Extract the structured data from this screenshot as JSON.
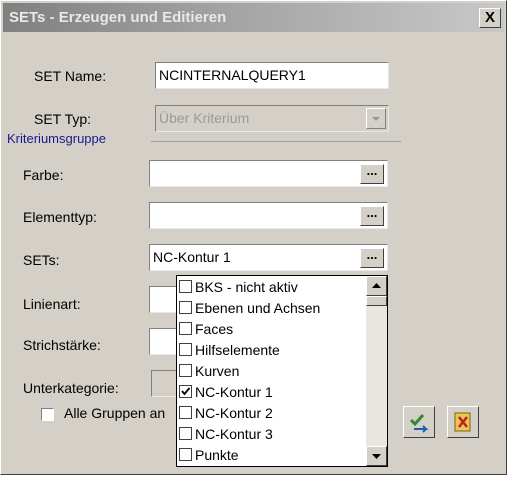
{
  "window": {
    "title": "SETs - Erzeugen und Editieren",
    "close_label": "X"
  },
  "form": {
    "set_name": {
      "label": "SET Name:",
      "value": "NCINTERNALQUERY1"
    },
    "set_typ": {
      "label": "SET Typ:",
      "value": "Über Kriterium"
    },
    "group_label": "Kriteriumsgruppe",
    "farbe": {
      "label": "Farbe:",
      "value": "",
      "button": "..."
    },
    "elementtyp": {
      "label": "Elementtyp:",
      "value": "",
      "button": "..."
    },
    "sets": {
      "label": "SETs:",
      "value": "NC-Kontur 1",
      "button": "..."
    },
    "linienart": {
      "label": "Linienart:"
    },
    "strichstaerke": {
      "label": "Strichstärke:"
    },
    "unterkategorie": {
      "label": "Unterkategorie:"
    },
    "alle_gruppen": {
      "label": "Alle Gruppen an",
      "checked": false
    }
  },
  "dropdown_list": {
    "items": [
      {
        "label": "BKS - nicht aktiv",
        "checked": false
      },
      {
        "label": "Ebenen und Achsen",
        "checked": false
      },
      {
        "label": "Faces",
        "checked": false
      },
      {
        "label": "Hilfselemente",
        "checked": false
      },
      {
        "label": "Kurven",
        "checked": false
      },
      {
        "label": "NC-Kontur 1",
        "checked": true
      },
      {
        "label": "NC-Kontur 2",
        "checked": false
      },
      {
        "label": "NC-Kontur 3",
        "checked": false
      },
      {
        "label": "Punkte",
        "checked": false
      }
    ]
  },
  "icons": {
    "apply": "apply-arrows-icon",
    "cancel": "cancel-icon",
    "accent": "#2c8a2c"
  }
}
